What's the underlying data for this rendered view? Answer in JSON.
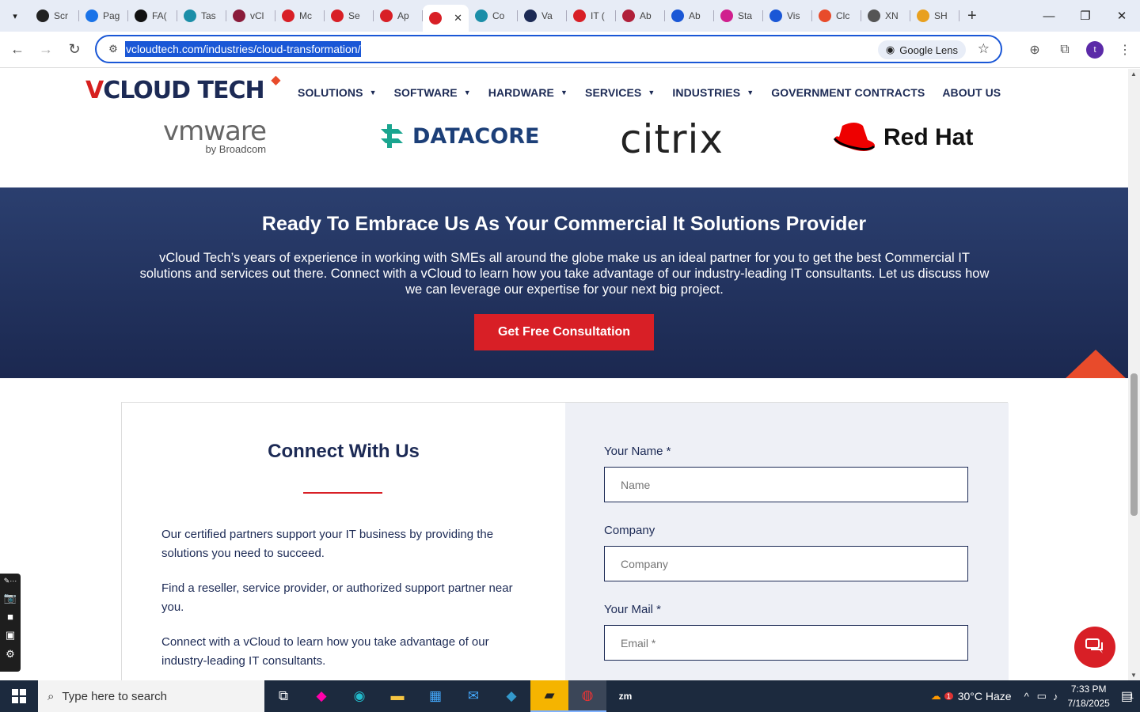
{
  "browser": {
    "tabs": [
      {
        "label": "Scr",
        "color": "#222"
      },
      {
        "label": "Pag",
        "color": "#1a73e8"
      },
      {
        "label": "FA(",
        "color": "#111"
      },
      {
        "label": "Tas",
        "color": "#1b8ea8"
      },
      {
        "label": "vCl",
        "color": "#8a1b3a"
      },
      {
        "label": "Mc",
        "color": "#d81f26"
      },
      {
        "label": "Se",
        "color": "#d81f26"
      },
      {
        "label": "Ap",
        "color": "#d81f26"
      },
      {
        "label": "",
        "color": "#d81f26",
        "active": true
      },
      {
        "label": "Co",
        "color": "#1b8ea8"
      },
      {
        "label": "Va",
        "color": "#1c2a55"
      },
      {
        "label": "IT (",
        "color": "#d81f26"
      },
      {
        "label": "Ab",
        "color": "#b0203a"
      },
      {
        "label": "Ab",
        "color": "#1a57d6"
      },
      {
        "label": "Sta",
        "color": "#d0208e"
      },
      {
        "label": "Vis",
        "color": "#1a57d6"
      },
      {
        "label": "Clc",
        "color": "#e84b2b"
      },
      {
        "label": "XN",
        "color": "#555"
      },
      {
        "label": "SH",
        "color": "#e8a020"
      }
    ],
    "url": "vcloudtech.com/industries/cloud-transformation/",
    "lens_label": "Google Lens",
    "profile_initial": "t"
  },
  "site": {
    "logo_v": "V",
    "logo_text": "CLOUD TECH",
    "nav": [
      "SOLUTIONS",
      "SOFTWARE",
      "HARDWARE",
      "SERVICES",
      "INDUSTRIES",
      "GOVERNMENT CONTRACTS",
      "ABOUT US"
    ],
    "partners": {
      "vmware": "vmware",
      "vmware_sub": "by Broadcom",
      "datacore": "DATACORE",
      "citrix": "citrix",
      "redhat": "Red Hat"
    },
    "cta": {
      "title": "Ready To Embrace Us As Your Commercial It Solutions Provider",
      "text": "vCloud Tech’s years of experience in working with SMEs all around the globe make us an ideal partner for you to get the best Commercial IT solutions and services out there. Connect with a vCloud to learn how you take advantage of our industry-leading IT consultants. Let us discuss how we can leverage our expertise for your next big project.",
      "button": "Get Free Consultation"
    },
    "contact": {
      "title": "Connect With Us",
      "paragraphs": [
        "Our certified partners support your IT business by providing the solutions you need to succeed.",
        "Find a reseller, service provider, or authorized support partner near you.",
        "Connect with a vCloud to learn how you take advantage of our industry-leading IT consultants."
      ],
      "fields": [
        {
          "label": "Your Name *",
          "placeholder": "Name"
        },
        {
          "label": "Company",
          "placeholder": "Company"
        },
        {
          "label": "Your Mail *",
          "placeholder": "Email *"
        }
      ]
    }
  },
  "taskbar": {
    "search_placeholder": "Type here to search",
    "weather": "30°C  Haze",
    "weather_badge": "1",
    "time": "7:33 PM",
    "date": "7/18/2025",
    "notif_count": "1"
  }
}
